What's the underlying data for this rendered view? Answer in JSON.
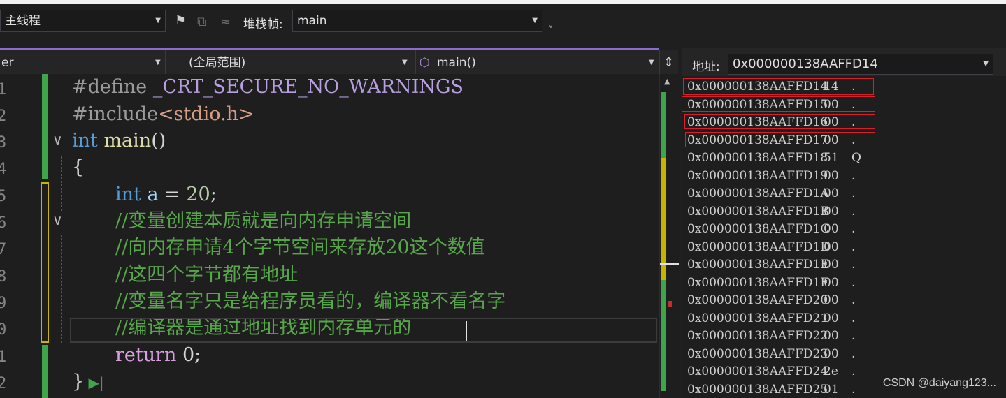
{
  "debug_toolbar": {
    "thread_combo": "主线程",
    "stack_frame_label": "堆栈帧:",
    "stack_frame_combo": "main"
  },
  "editor": {
    "nav": {
      "project": "er",
      "scope": "(全局范围)",
      "function": "main()"
    },
    "line_numbers": [
      "1",
      "2",
      "3",
      "4",
      "5",
      "6",
      "7",
      "8",
      "9",
      "0",
      "1",
      "2"
    ],
    "code": {
      "l1_directive": "#define",
      "l1_macro": " _CRT_SECURE_NO_WARNINGS",
      "l2_directive": "#include",
      "l2_header": "<stdio.h>",
      "l3_type": "int",
      "l3_name": " main",
      "l3_parens": "()",
      "l4": "{",
      "l5_type": "int",
      "l5_var": " a",
      "l5_op": " = ",
      "l5_num": "20",
      "l5_end": ";",
      "l6": "//变量创建本质就是向内存申请空间",
      "l7": "//向内存申请4个字节空间来存放20这个数值",
      "l8": "//这四个字节都有地址",
      "l9": "//变量名字只是给程序员看的，编译器不看名字",
      "l10": "//编译器是通过地址找到内存单元的",
      "l11_kw": "return",
      "l11_rest": " 0;",
      "l12": "}"
    }
  },
  "memory": {
    "address_label": "地址:",
    "address_value": "0x000000138AAFFD14",
    "rows": [
      {
        "addr": "0x000000138AAFFD14",
        "hex": "14",
        "ch": "."
      },
      {
        "addr": "0x000000138AAFFD15",
        "hex": "00",
        "ch": "."
      },
      {
        "addr": "0x000000138AAFFD16",
        "hex": "00",
        "ch": "."
      },
      {
        "addr": "0x000000138AAFFD17",
        "hex": "00",
        "ch": "."
      },
      {
        "addr": "0x000000138AAFFD18",
        "hex": "51",
        "ch": "Q"
      },
      {
        "addr": "0x000000138AAFFD19",
        "hex": "00",
        "ch": "."
      },
      {
        "addr": "0x000000138AAFFD1A",
        "hex": "00",
        "ch": "."
      },
      {
        "addr": "0x000000138AAFFD1B",
        "hex": "00",
        "ch": "."
      },
      {
        "addr": "0x000000138AAFFD1C",
        "hex": "00",
        "ch": "."
      },
      {
        "addr": "0x000000138AAFFD1D",
        "hex": "00",
        "ch": "."
      },
      {
        "addr": "0x000000138AAFFD1E",
        "hex": "00",
        "ch": "."
      },
      {
        "addr": "0x000000138AAFFD1F",
        "hex": "00",
        "ch": "."
      },
      {
        "addr": "0x000000138AAFFD20",
        "hex": "00",
        "ch": "."
      },
      {
        "addr": "0x000000138AAFFD21",
        "hex": "00",
        "ch": "."
      },
      {
        "addr": "0x000000138AAFFD22",
        "hex": "00",
        "ch": "."
      },
      {
        "addr": "0x000000138AAFFD23",
        "hex": "00",
        "ch": "."
      },
      {
        "addr": "0x000000138AAFFD24",
        "hex": "2e",
        "ch": "."
      },
      {
        "addr": "0x000000138AAFFD25",
        "hex": "01",
        "ch": "."
      }
    ]
  },
  "watermark": "CSDN @daiyang123...",
  "colors": {
    "accent": "#8a6bcf",
    "highlight_box": "#d9202a",
    "change_bar": "#3fa54a",
    "unsaved_bar": "#c8b400"
  }
}
